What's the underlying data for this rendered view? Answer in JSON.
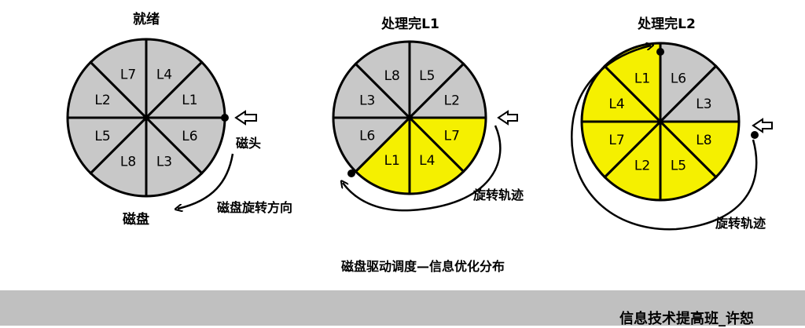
{
  "colors": {
    "gray": "#c8c8c8",
    "yellow": "#f5f000",
    "stroke": "#000000",
    "footer": "#c0c0c0"
  },
  "disks": [
    {
      "title": "就绪",
      "sectors": [
        {
          "label": "L4",
          "fill": "gray"
        },
        {
          "label": "L1",
          "fill": "gray"
        },
        {
          "label": "L6",
          "fill": "gray"
        },
        {
          "label": "L3",
          "fill": "gray"
        },
        {
          "label": "L8",
          "fill": "gray"
        },
        {
          "label": "L5",
          "fill": "gray"
        },
        {
          "label": "L2",
          "fill": "gray"
        },
        {
          "label": "L7",
          "fill": "gray"
        }
      ],
      "head_label": "磁头",
      "disk_label": "磁盘",
      "rotation_label": "磁盘旋转方向"
    },
    {
      "title": "处理完L1",
      "sectors": [
        {
          "label": "L5",
          "fill": "gray"
        },
        {
          "label": "L2",
          "fill": "gray"
        },
        {
          "label": "L7",
          "fill": "yellow"
        },
        {
          "label": "L4",
          "fill": "yellow"
        },
        {
          "label": "L1",
          "fill": "yellow"
        },
        {
          "label": "L6",
          "fill": "gray"
        },
        {
          "label": "L3",
          "fill": "gray"
        },
        {
          "label": "L8",
          "fill": "gray"
        }
      ],
      "rotation_label": "旋转轨迹"
    },
    {
      "title": "处理完L2",
      "sectors": [
        {
          "label": "L6",
          "fill": "gray"
        },
        {
          "label": "L3",
          "fill": "gray"
        },
        {
          "label": "L8",
          "fill": "yellow"
        },
        {
          "label": "L5",
          "fill": "yellow"
        },
        {
          "label": "L2",
          "fill": "yellow"
        },
        {
          "label": "L7",
          "fill": "yellow"
        },
        {
          "label": "L4",
          "fill": "yellow"
        },
        {
          "label": "L1",
          "fill": "yellow"
        }
      ],
      "rotation_label": "旋转轨迹"
    }
  ],
  "caption": "磁盘驱动调度—信息优化分布",
  "footer": "信息技术提高班_许恕"
}
